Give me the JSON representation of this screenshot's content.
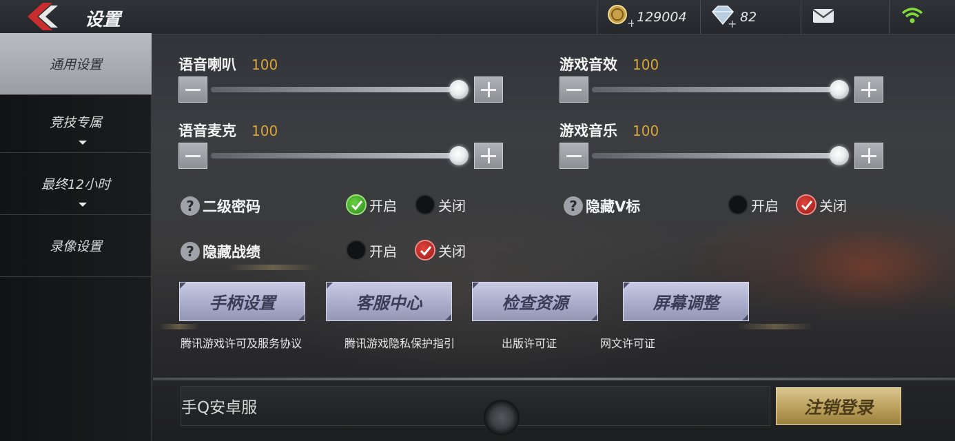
{
  "header": {
    "title": "设置",
    "coins": "129004",
    "diamonds": "82"
  },
  "sidebar": {
    "items": [
      {
        "label": "通用设置",
        "active": true
      },
      {
        "label": "竞技专属",
        "active": false
      },
      {
        "label": "最终12小时",
        "active": false
      },
      {
        "label": "录像设置",
        "active": false
      }
    ]
  },
  "sliders": {
    "voice_speaker": {
      "label": "语音喇叭",
      "value": "100"
    },
    "game_sfx": {
      "label": "游戏音效",
      "value": "100"
    },
    "voice_mic": {
      "label": "语音麦克",
      "value": "100"
    },
    "game_music": {
      "label": "游戏音乐",
      "value": "100"
    }
  },
  "toggles": {
    "second_password": {
      "label": "二级密码",
      "on": "开启",
      "off": "关闭",
      "selected": "开启"
    },
    "hide_v_badge": {
      "label": "隐藏V标",
      "on": "开启",
      "off": "关闭",
      "selected": "关闭"
    },
    "hide_record": {
      "label": "隐藏战绩",
      "on": "开启",
      "off": "关闭",
      "selected": "关闭"
    }
  },
  "actions": {
    "controller": "手柄设置",
    "support": "客服中心",
    "check_resources": "检查资源",
    "screen_adjust": "屏幕调整"
  },
  "links": {
    "license_agreement": "腾讯游戏许可及服务协议",
    "privacy": "腾讯游戏隐私保护指引",
    "publish_license": "出版许可证",
    "web_culture_license": "网文许可证"
  },
  "footer": {
    "server": "手Q安卓服",
    "logout": "注销登录"
  },
  "colors": {
    "accent_gold": "#d9a53a",
    "active_green": "#4fbf2e",
    "active_red": "#d1302a",
    "wifi_green": "#7fd93b"
  }
}
